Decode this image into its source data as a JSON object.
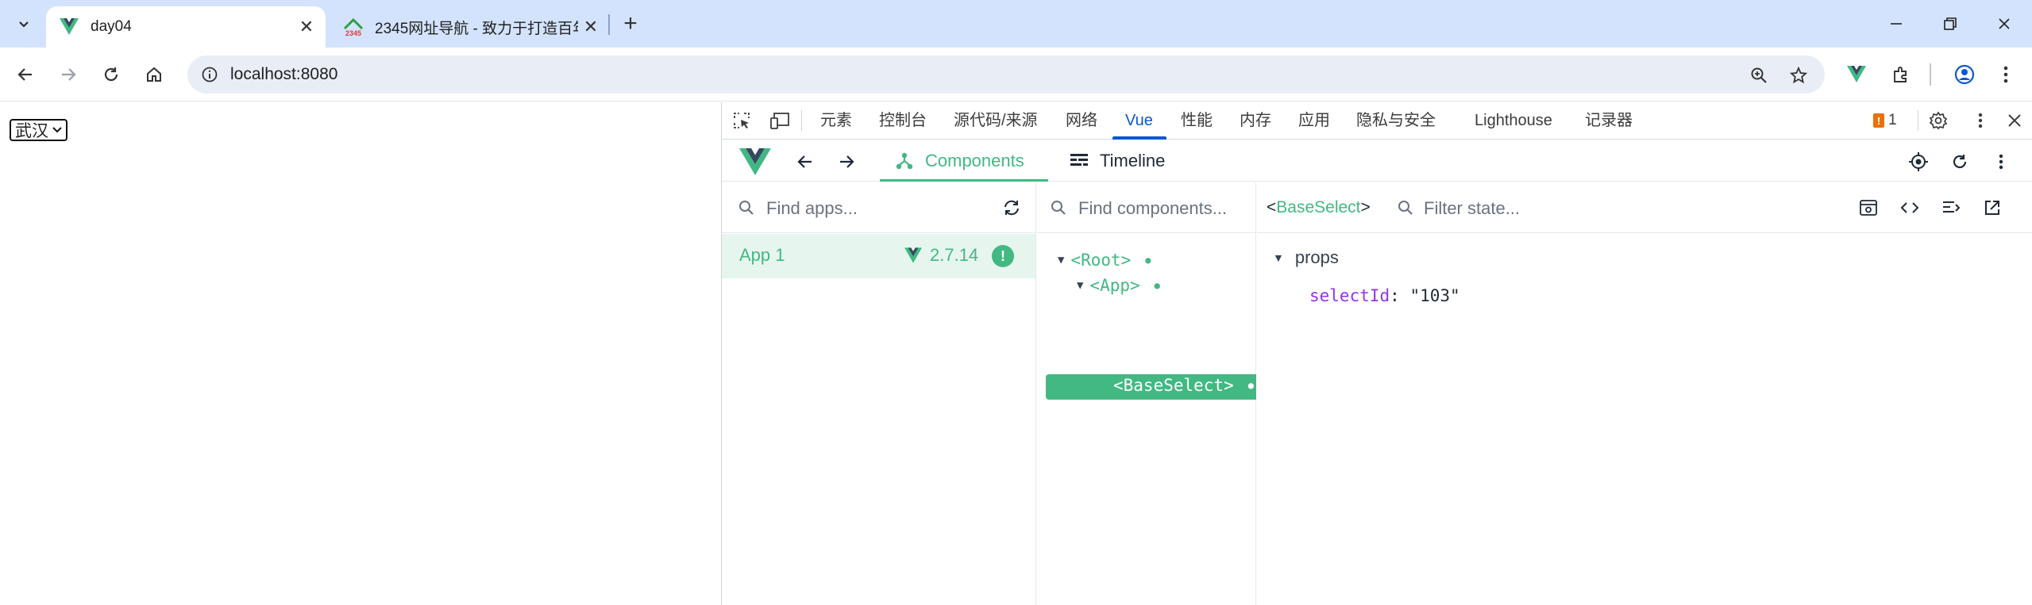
{
  "browser": {
    "tabs": [
      {
        "title": "day04",
        "active": true,
        "favicon": "vue-logo-icon"
      },
      {
        "title": "2345网址导航 - 致力于打造百年",
        "active": false,
        "favicon": "2345-logo-icon"
      }
    ],
    "url": "localhost:8080"
  },
  "page": {
    "city_select": {
      "value": "武汉"
    }
  },
  "devtools": {
    "tabs": [
      "元素",
      "控制台",
      "源代码/来源",
      "网络",
      "Vue",
      "性能",
      "内存",
      "应用",
      "隐私与安全",
      "Lighthouse",
      "记录器"
    ],
    "active_tab": "Vue",
    "issue_count": "1",
    "vue": {
      "tabs": [
        {
          "label": "Components",
          "active": true,
          "icon": "components-icon"
        },
        {
          "label": "Timeline",
          "active": false,
          "icon": "timeline-icon"
        }
      ],
      "apps_search_placeholder": "Find apps...",
      "app": {
        "name": "App 1",
        "version": "2.7.14"
      },
      "components_search_placeholder": "Find components...",
      "tree": [
        {
          "label": "<Root>",
          "depth": 0,
          "expanded": true,
          "selected": false
        },
        {
          "label": "<App>",
          "depth": 1,
          "expanded": true,
          "selected": false
        },
        {
          "label": "<BaseSelect>",
          "depth": 2,
          "expanded": false,
          "selected": true
        }
      ],
      "selected_component": "BaseSelect",
      "state_filter_placeholder": "Filter state...",
      "props_section": "props",
      "props": [
        {
          "key": "selectId",
          "value": "\"103\""
        }
      ]
    }
  },
  "colors": {
    "vue_green": "#42b883",
    "tabstrip": "#d3e3fd",
    "devtools_active": "#0b57d0",
    "prop_key": "#9333ea"
  }
}
